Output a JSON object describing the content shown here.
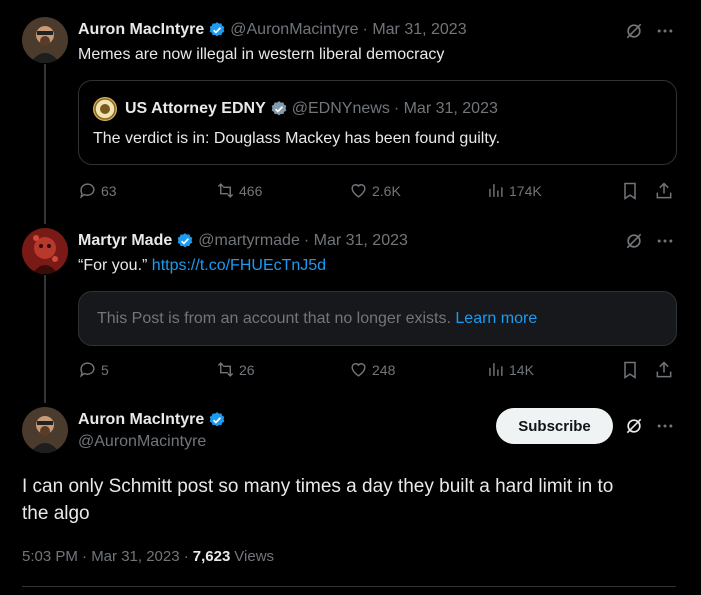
{
  "tweets": [
    {
      "name": "Auron MacIntyre",
      "handle": "@AuronMacintyre",
      "date": "· Mar 31, 2023",
      "text": "Memes are now illegal in western liberal democracy",
      "quote": {
        "name": "US Attorney EDNY",
        "handle": "@EDNYnews",
        "date": "· Mar 31, 2023",
        "text": "The verdict is in: Douglass Mackey has been found guilty."
      },
      "stats": {
        "replies": "63",
        "reposts": "466",
        "likes": "2.6K",
        "views": "174K"
      }
    },
    {
      "name": "Martyr Made",
      "handle": "@martyrmade",
      "date": "· Mar 31, 2023",
      "text": "“For you.”",
      "link": "https://t.co/FHUEcTnJ5d",
      "notice": {
        "text": "This Post is from an account that no longer exists.",
        "link": "Learn more"
      },
      "stats": {
        "replies": "5",
        "reposts": "26",
        "likes": "248",
        "views": "14K"
      }
    }
  ],
  "main": {
    "name": "Auron MacIntyre",
    "handle": "@AuronMacintyre",
    "subscribe": "Subscribe",
    "text_line1": "I can only Schmitt post so many times a day they built a hard limit in to",
    "text_line2": "the algo",
    "time": "5:03 PM · Mar 31, 2023 ·",
    "views_count": "7,623",
    "views_label": "Views"
  },
  "colors": {
    "accent": "#1d9bf0",
    "muted": "#71767b",
    "text": "#e7e9ea",
    "border": "#2f3336"
  }
}
